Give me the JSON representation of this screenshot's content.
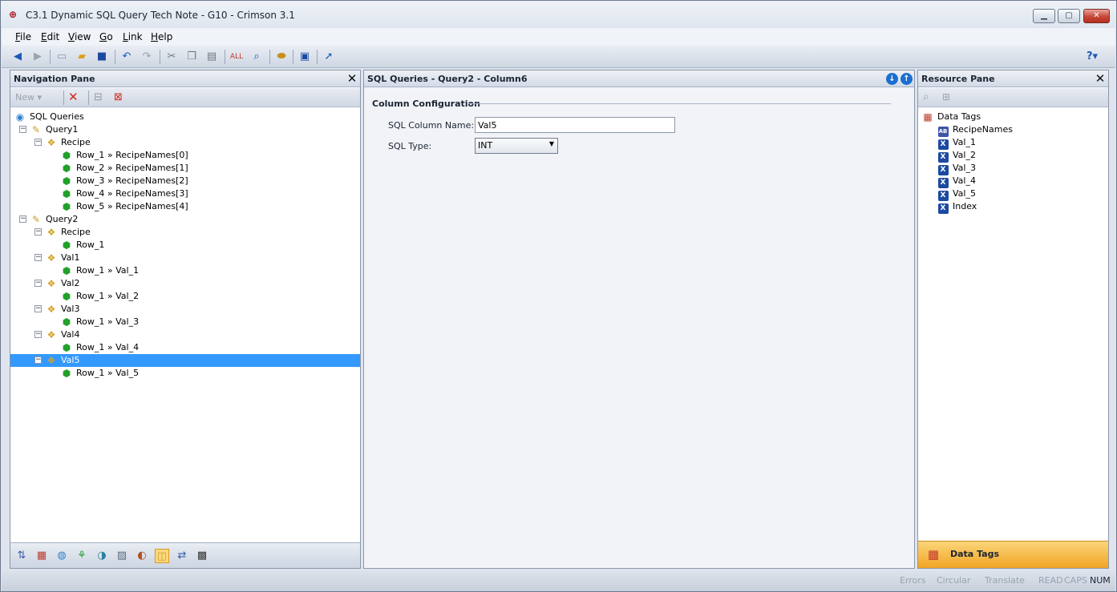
{
  "window": {
    "title": "C3.1 Dynamic SQL Query Tech Note - G10 - Crimson 3.1",
    "min_glyph": "▁",
    "max_glyph": "▢",
    "close_glyph": "✕"
  },
  "menu": {
    "items": [
      {
        "first": "F",
        "rest": "ile"
      },
      {
        "first": "E",
        "rest": "dit"
      },
      {
        "first": "V",
        "rest": "iew"
      },
      {
        "first": "G",
        "rest": "o"
      },
      {
        "first": "L",
        "rest": "ink"
      },
      {
        "first": "H",
        "rest": "elp"
      }
    ]
  },
  "toolbar": {
    "icons": [
      "back-icon",
      "forward-icon",
      "new-file-icon",
      "open-folder-icon",
      "save-icon",
      "undo-icon",
      "redo-icon",
      "cut-icon",
      "copy-icon",
      "paste-icon",
      "find-all-icon",
      "find-icon",
      "link-icon",
      "monitor-icon",
      "send-icon"
    ],
    "help_glyph": "?▾"
  },
  "navigation": {
    "title": "Navigation Pane",
    "new_label": "New ▾",
    "close_glyph": "✕",
    "tree": [
      {
        "label": "SQL Queries",
        "icon": "sql-queries-icon",
        "level": 0,
        "expander": "",
        "type": "root"
      },
      {
        "label": "Query1",
        "icon": "query-icon",
        "level": 1,
        "expander": "−",
        "type": "query"
      },
      {
        "label": "Recipe",
        "icon": "column-icon",
        "level": 2,
        "expander": "−",
        "type": "column"
      },
      {
        "label": "Row_1 » RecipeNames[0]",
        "icon": "cube-icon",
        "level": 3,
        "expander": "",
        "type": "row"
      },
      {
        "label": "Row_2 » RecipeNames[1]",
        "icon": "cube-icon",
        "level": 3,
        "expander": "",
        "type": "row"
      },
      {
        "label": "Row_3 » RecipeNames[2]",
        "icon": "cube-icon",
        "level": 3,
        "expander": "",
        "type": "row"
      },
      {
        "label": "Row_4 » RecipeNames[3]",
        "icon": "cube-icon",
        "level": 3,
        "expander": "",
        "type": "row"
      },
      {
        "label": "Row_5 » RecipeNames[4]",
        "icon": "cube-icon",
        "level": 3,
        "expander": "",
        "type": "row"
      },
      {
        "label": "Query2",
        "icon": "query-icon",
        "level": 1,
        "expander": "−",
        "type": "query"
      },
      {
        "label": "Recipe",
        "icon": "column-icon",
        "level": 2,
        "expander": "−",
        "type": "column"
      },
      {
        "label": "Row_1",
        "icon": "cube-icon",
        "level": 3,
        "expander": "",
        "type": "row"
      },
      {
        "label": "Val1",
        "icon": "column-icon",
        "level": 2,
        "expander": "−",
        "type": "column"
      },
      {
        "label": "Row_1 » Val_1",
        "icon": "cube-icon",
        "level": 3,
        "expander": "",
        "type": "row"
      },
      {
        "label": "Val2",
        "icon": "column-icon",
        "level": 2,
        "expander": "−",
        "type": "column"
      },
      {
        "label": "Row_1 » Val_2",
        "icon": "cube-icon",
        "level": 3,
        "expander": "",
        "type": "row"
      },
      {
        "label": "Val3",
        "icon": "column-icon",
        "level": 2,
        "expander": "−",
        "type": "column"
      },
      {
        "label": "Row_1 » Val_3",
        "icon": "cube-icon",
        "level": 3,
        "expander": "",
        "type": "row"
      },
      {
        "label": "Val4",
        "icon": "column-icon",
        "level": 2,
        "expander": "−",
        "type": "column"
      },
      {
        "label": "Row_1 » Val_4",
        "icon": "cube-icon",
        "level": 3,
        "expander": "",
        "type": "row"
      },
      {
        "label": "Val5",
        "icon": "column-icon",
        "level": 2,
        "expander": "−",
        "type": "column",
        "selected": true
      },
      {
        "label": "Row_1 » Val_5",
        "icon": "cube-icon",
        "level": 3,
        "expander": "",
        "type": "row"
      }
    ],
    "footer_icons": [
      "comms-icon",
      "data-tags-icon",
      "display-pages-icon",
      "programs-icon",
      "web-server-icon",
      "data-logger-icon",
      "security-icon",
      "sql-queries-icon",
      "sql-sync-icon",
      "control-icon"
    ],
    "footer_selected": 7
  },
  "center": {
    "title": "SQL Queries - Query2 - Column6",
    "section_title": "Column Configuration",
    "fields": {
      "column_name_label": "SQL Column Name:",
      "column_name_value": "Val5",
      "type_label": "SQL Type:",
      "type_value": "INT"
    }
  },
  "resource": {
    "title": "Resource Pane",
    "close_glyph": "✕",
    "tree": [
      {
        "label": "Data Tags",
        "icon": "data-tags-icon",
        "level": 0,
        "kind": "root"
      },
      {
        "label": "RecipeNames",
        "icon": "string-tag-icon",
        "level": 1,
        "kind": "string"
      },
      {
        "label": "Val_1",
        "icon": "numeric-tag-icon",
        "level": 1,
        "kind": "numeric"
      },
      {
        "label": "Val_2",
        "icon": "numeric-tag-icon",
        "level": 1,
        "kind": "numeric"
      },
      {
        "label": "Val_3",
        "icon": "numeric-tag-icon",
        "level": 1,
        "kind": "numeric"
      },
      {
        "label": "Val_4",
        "icon": "numeric-tag-icon",
        "level": 1,
        "kind": "numeric"
      },
      {
        "label": "Val_5",
        "icon": "numeric-tag-icon",
        "level": 1,
        "kind": "numeric"
      },
      {
        "label": "Index",
        "icon": "numeric-tag-icon",
        "level": 1,
        "kind": "numeric"
      }
    ],
    "footer_label": "Data Tags"
  },
  "status": {
    "items": [
      {
        "label": "Errors",
        "active": false
      },
      {
        "label": "Circular",
        "active": false
      },
      {
        "label": "Translate",
        "active": false
      },
      {
        "label": "READ",
        "active": false
      },
      {
        "label": "CAPS",
        "active": false
      },
      {
        "label": "NUM",
        "active": true
      }
    ]
  },
  "colors": {
    "selection": "#3399ff",
    "accent_footer": "#f1a424"
  }
}
